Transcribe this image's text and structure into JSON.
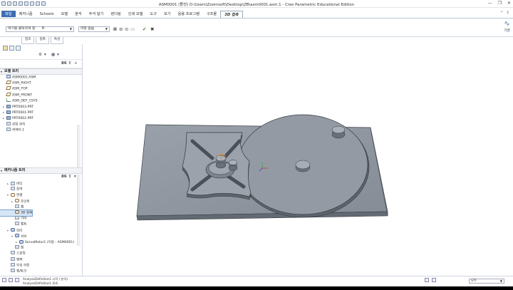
{
  "window": {
    "title": "ASM0001 (활성) D:\\Users\\Zoomsoft\\Desktop\\ZB\\asm0001.asm.1 - Creo Parametric Educational Edition",
    "minimize_glyph": "—",
    "restore_glyph": "❐",
    "close_glyph": "✕"
  },
  "menu": {
    "tabs": [
      "파일",
      "메카니즘",
      "Schools",
      "모델",
      "분석",
      "주석 달기",
      "렌더링",
      "인쇄 모델",
      "도구",
      "보기",
      "응용 프로그램",
      "구조물",
      "3D 접촉"
    ],
    "active_tab": "3D 접촉"
  },
  "ribbon": {
    "reference_dropdown": "여기를 클릭하여 항",
    "reference_value": "R",
    "type_dropdown": "마찰 없음",
    "pause_glyph": "II",
    "check_glyph": "✔",
    "cancel_glyph": "✖",
    "right_label": "기본",
    "arrow_glyph": "▼",
    "subtabs": [
      "참조",
      "접촉",
      "특성"
    ]
  },
  "left_panel": {
    "model_tree_title": "모델 트리",
    "model_tree_items": [
      {
        "label": "ASM0001.ASM",
        "icon": "assembly-icon",
        "expand": ""
      },
      {
        "label": "ASM_RIGHT",
        "icon": "datum-plane-icon",
        "expand": ""
      },
      {
        "label": "ASM_TOP",
        "icon": "datum-plane-icon",
        "expand": ""
      },
      {
        "label": "ASM_FRONT",
        "icon": "datum-plane-icon",
        "expand": ""
      },
      {
        "label": "ASM_DEF_CSYS",
        "icon": "csys-icon",
        "expand": ""
      },
      {
        "label": "PRT0003.PRT",
        "icon": "part-icon",
        "expand": "▸"
      },
      {
        "label": "PRT0001.PRT",
        "icon": "part-icon",
        "expand": "▸"
      },
      {
        "label": "PRT0002.PRT",
        "icon": "part-icon",
        "expand": "▸"
      },
      {
        "label": "삽입 위치",
        "icon": "insert-here-icon",
        "expand": ""
      },
      {
        "label": "커넥터 1",
        "icon": "connector-icon",
        "expand": ""
      }
    ],
    "mechanism_tree_title": "메카니즘 트리",
    "mechanism_tree_items": [
      {
        "label": "바디",
        "icon": "body-icon",
        "expand": "▸",
        "indent": 1
      },
      {
        "label": "중력",
        "icon": "gravity-icon",
        "expand": "",
        "indent": 1
      },
      {
        "label": "연결",
        "icon": "connection-icon",
        "expand": "▾",
        "indent": 1
      },
      {
        "label": "조인트",
        "icon": "joint-icon",
        "expand": "▸",
        "indent": 2
      },
      {
        "label": "캠",
        "icon": "cam-icon",
        "expand": "",
        "indent": 2
      },
      {
        "label": "3D 접촉",
        "icon": "contact-3d-icon",
        "expand": "",
        "indent": 2
      },
      {
        "label": "기어",
        "icon": "gear-icon",
        "expand": "",
        "indent": 2
      },
      {
        "label": "벨트",
        "icon": "belt-icon",
        "expand": "",
        "indent": 2
      },
      {
        "label": "모터",
        "icon": "motor-icon",
        "expand": "▾",
        "indent": 1
      },
      {
        "label": "서보",
        "icon": "servo-icon",
        "expand": "▾",
        "indent": 2
      },
      {
        "label": "ServoMotor1 (이동 - ASM0001)",
        "icon": "servo-motor-icon",
        "expand": "▸",
        "indent": 3
      },
      {
        "label": "힘",
        "icon": "force-icon",
        "expand": "",
        "indent": 2
      },
      {
        "label": "스프링",
        "icon": "spring-icon",
        "expand": "",
        "indent": 1
      },
      {
        "label": "댐퍼",
        "icon": "damper-icon",
        "expand": "",
        "indent": 1
      },
      {
        "label": "부싱 하중",
        "icon": "bushing-icon",
        "expand": "",
        "indent": 1
      },
      {
        "label": "힘/토크",
        "icon": "force-torque-icon",
        "expand": "",
        "indent": 1
      }
    ],
    "selected_mechanism_item": "3D 접촉"
  },
  "status": {
    "messages": [
      "AnalysisDefinition1 시작 ( 분석).",
      "AnalysisDefinition1 완료."
    ],
    "selection_filter": "모두"
  },
  "colors": {
    "file_tab": "#3c6db3",
    "part_gray": "#8e959f",
    "part_edge": "#3a3f45"
  }
}
